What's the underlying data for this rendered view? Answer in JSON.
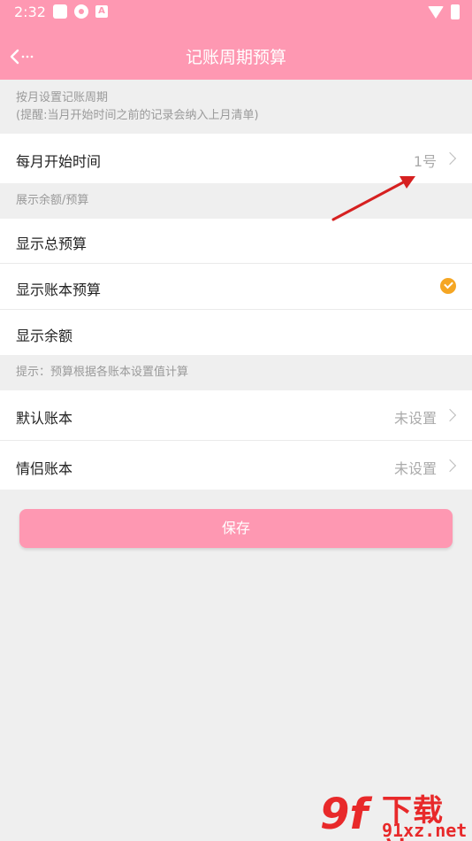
{
  "status_bar": {
    "time": "2:32"
  },
  "header": {
    "title": "记账周期预算",
    "back_icon": "back-arrow-icon"
  },
  "cycle_section": {
    "label_line1": "按月设置记账周期",
    "label_line2": "(提醒:当月开始时间之前的记录会纳入上月清单)",
    "start_row": {
      "label": "每月开始时间",
      "value": "1号"
    }
  },
  "display_section": {
    "label": "展示余额/预算",
    "options": [
      {
        "label": "显示总预算",
        "checked": false
      },
      {
        "label": "显示账本预算",
        "checked": true
      },
      {
        "label": "显示余额",
        "checked": false
      }
    ]
  },
  "budget_section": {
    "label": "提示：预算根据各账本设置值计算",
    "rows": [
      {
        "label": "默认账本",
        "value": "未设置"
      },
      {
        "label": "情侣账本",
        "value": "未设置"
      }
    ]
  },
  "save_button": {
    "label": "保存"
  },
  "watermark": {
    "logo": "9f",
    "line1": "下载站",
    "line2": "91xz.net"
  },
  "colors": {
    "brand_pink": "#fe98b2",
    "check_orange": "#f5a623",
    "annotation_arrow": "#d62020"
  }
}
